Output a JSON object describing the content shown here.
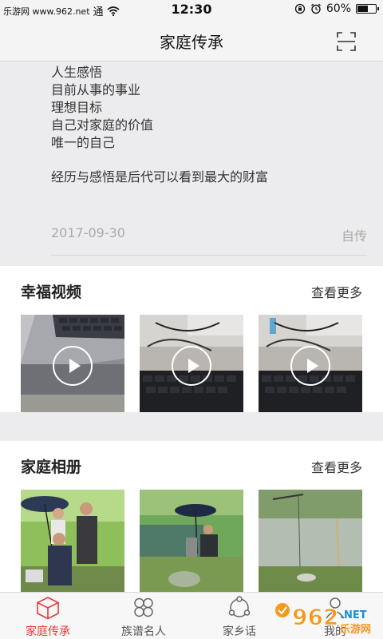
{
  "status_bar": {
    "left_text": "乐游网 www.962.net",
    "carrier": "通",
    "time": "12:30",
    "battery_text": "60%",
    "battery_level": 0.6
  },
  "nav": {
    "title": "家庭传承"
  },
  "bio": {
    "lines": [
      "人生感悟",
      "目前从事的事业",
      "理想目标",
      "自己对家庭的价值",
      "唯一的自己"
    ],
    "summary": "经历与感悟是后代可以看到最大的财富",
    "date": "2017-09-30",
    "tag": "自传"
  },
  "videos": {
    "title": "幸福视频",
    "more": "查看更多"
  },
  "album": {
    "title": "家庭相册",
    "more": "查看更多"
  },
  "tabs": [
    {
      "label": "家庭传承",
      "icon": "cube-icon",
      "active": true
    },
    {
      "label": "族谱名人",
      "icon": "clover-icon",
      "active": false
    },
    {
      "label": "家乡话",
      "icon": "share-icon",
      "active": false
    },
    {
      "label": "我的",
      "icon": "person-icon",
      "active": false
    }
  ],
  "watermark": {
    "brand": "962",
    "suffix": ".NET",
    "site": "乐游网"
  },
  "colors": {
    "accent": "#e4393c",
    "watermark_orange": "#f39a1e"
  }
}
